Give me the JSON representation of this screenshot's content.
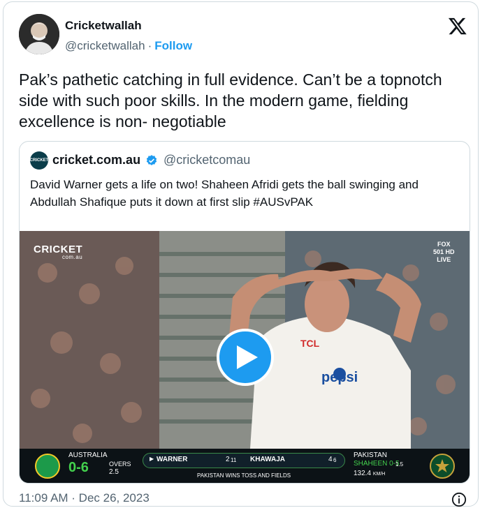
{
  "author": {
    "name": "Cricketwallah",
    "handle": "@cricketwallah",
    "separator": "·",
    "follow_label": "Follow",
    "avatar_icon": "profile-photo"
  },
  "tweet": {
    "text": "Pak’s pathetic catching in full evidence. Can’t be a topnotch side with such poor skills. In the modern game, fielding excellence is non- negotiable",
    "timestamp": "11:09 AM · Dec 26, 2023"
  },
  "quoted": {
    "name": "cricket.com.au",
    "handle": "@cricketcomau",
    "logo_text": "CRICKET",
    "text": "David Warner gets a life on two! Shaheen Afridi gets the ball swinging and Abdullah Shafique puts it down at first slip #AUSvPAK",
    "video": {
      "logo_text": "CRICKET",
      "logo_sub": "com.au",
      "broadcaster_line1": "FOX",
      "broadcaster_line2": "501 HD",
      "broadcaster_line3": "LIVE",
      "shirt_sponsor": "TCL",
      "shirt_brand": "pepsi"
    }
  },
  "scoreboard": {
    "team1": "AUSTRALIA",
    "team1_score": "0-6",
    "overs_label": "OVERS",
    "overs": "2.5",
    "batter1": "WARNER",
    "batter1_runs": "2",
    "batter1_balls": "11",
    "batter2": "KHAWAJA",
    "batter2_runs": "4",
    "batter2_balls": "6",
    "note": "PAKISTAN WINS TOSS AND FIELDS",
    "team2": "PAKISTAN",
    "bowler": "SHAHEEN 0-5",
    "bowler_overs": "1.5",
    "speed": "132.4",
    "speed_unit": "KM/H"
  },
  "colors": {
    "accent": "#1d9bf0",
    "text": "#0f1419",
    "muted": "#536471",
    "border": "#cfd9de",
    "score_green": "#43d14d"
  }
}
